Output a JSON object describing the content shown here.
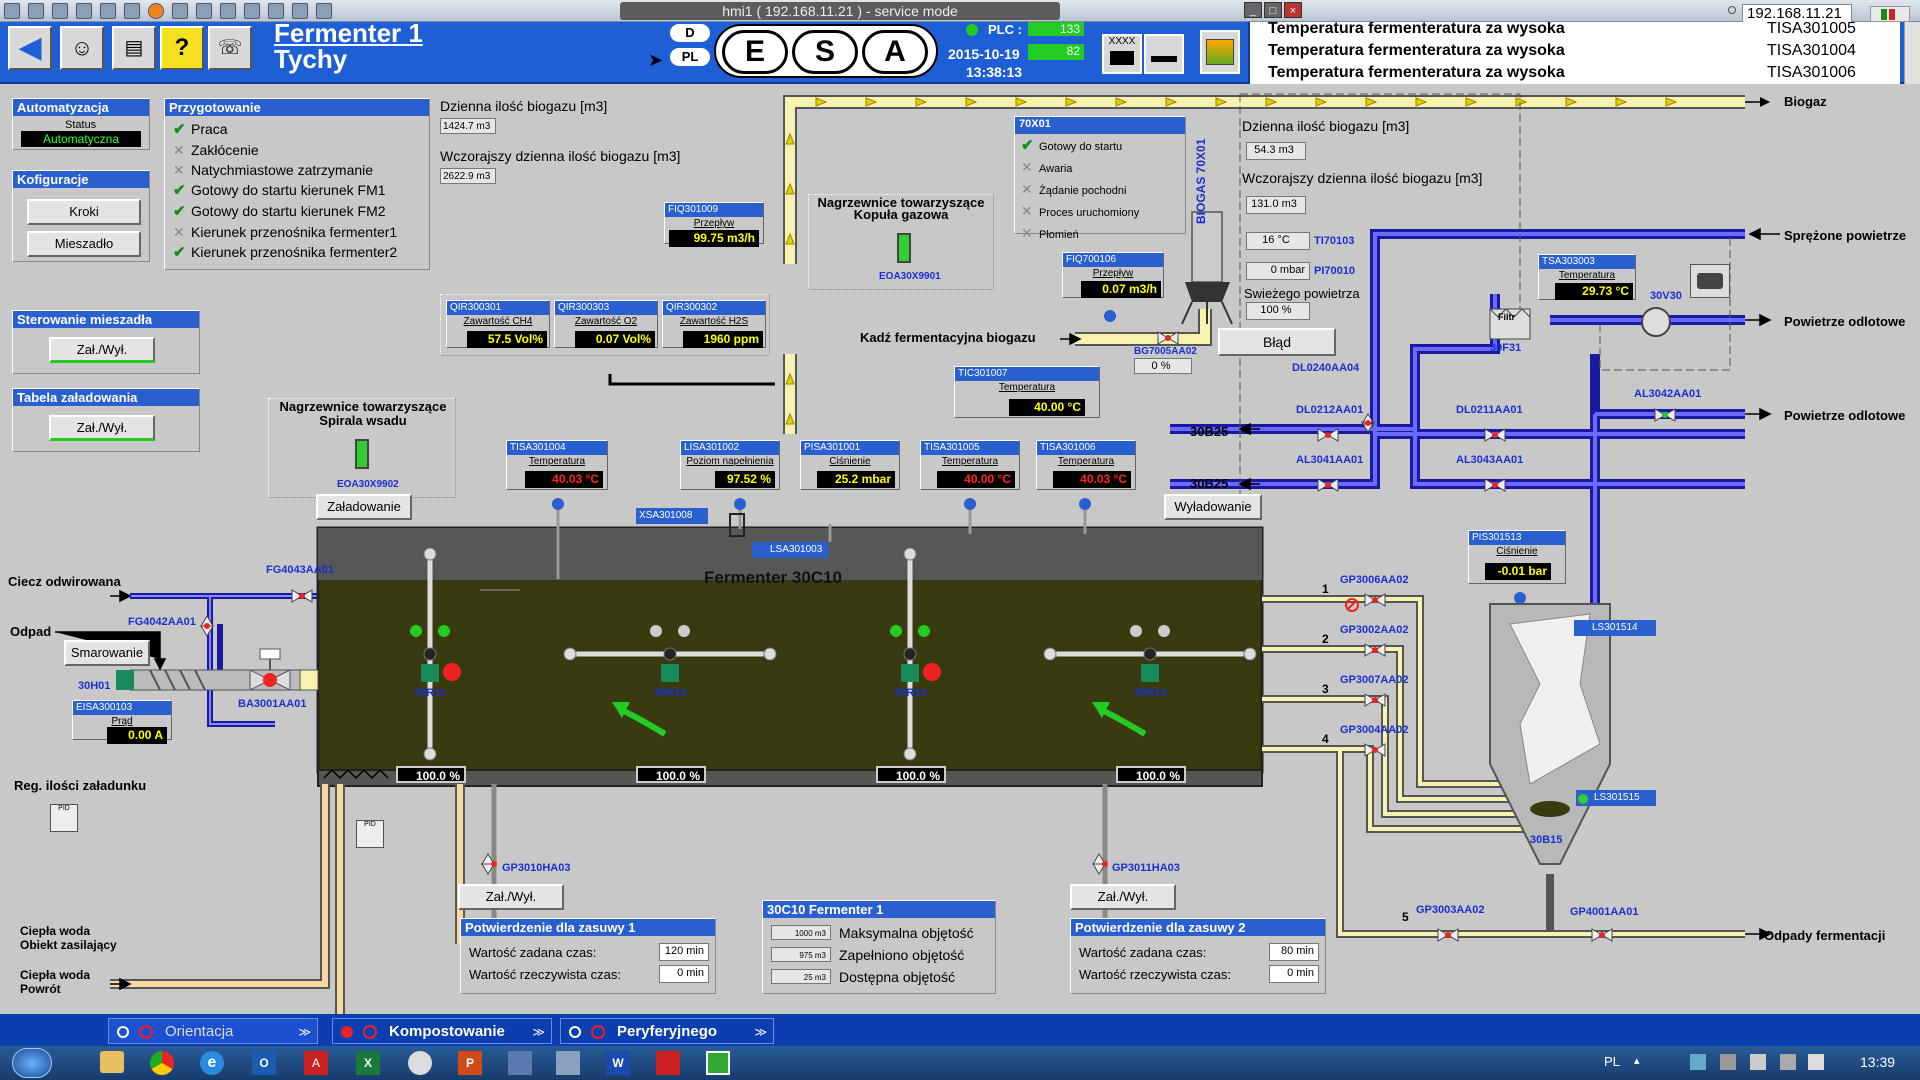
{
  "window": {
    "title": "hmi1 ( 192.168.11.21 ) - service mode",
    "ip": "192.168.11.21"
  },
  "header": {
    "title": "Fermenter 1",
    "subtitle": "Tychy",
    "d_label": "D",
    "pl_label": "PL",
    "logo_letters": [
      "E",
      "S",
      "A"
    ],
    "plc_label": "PLC :",
    "plc_val1": "133",
    "plc_val2": "82",
    "date": "2015-10-19",
    "time": "13:38:13",
    "xxxx": "XXXX"
  },
  "alarms": [
    {
      "text": "Temperatura fermenteratura za wysoka",
      "tag": "TISA301005"
    },
    {
      "text": "Temperatura fermenteratura za wysoka",
      "tag": "TISA301004"
    },
    {
      "text": "Temperatura fermenteratura za wysoka",
      "tag": "TISA301006"
    }
  ],
  "automation": {
    "title": "Automatyzacja",
    "status_label": "Status",
    "status_value": "Automatyczna"
  },
  "config": {
    "title": "Kofiguracje",
    "btn1": "Kroki",
    "btn2": "Mieszadło"
  },
  "prep": {
    "title": "Przygotowanie",
    "items": [
      {
        "label": "Praca",
        "state": "check"
      },
      {
        "label": "Zakłócenie",
        "state": "x"
      },
      {
        "label": "Natychmiastowe zatrzymanie",
        "state": "x"
      },
      {
        "label": "Gotowy do startu kierunek FM1",
        "state": "check"
      },
      {
        "label": "Gotowy do startu kierunek FM2",
        "state": "check"
      },
      {
        "label": "Kierunek  przenośnika fermenter1",
        "state": "x"
      },
      {
        "label": "Kierunek  przenośnika fermenter2",
        "state": "check"
      }
    ]
  },
  "mixer_ctrl": {
    "title": "Sterowanie mieszadła",
    "btn": "Zał./Wył."
  },
  "load_table": {
    "title": "Tabela załadowania",
    "btn": "Zał./Wył."
  },
  "biogas_daily": {
    "label": "Dzienna ilość biogazu [m3]",
    "value": "1424.7 m3",
    "label2": "Wczorajszy dzienna ilość biogazu [m3]",
    "value2": "2622.9 m3"
  },
  "biogas_daily2": {
    "label": "Dzienna ilość biogazu [m3]",
    "value": "54.3 m3",
    "label2": "Wczorajszy dzienna ilość biogazu [m3]",
    "value2": "131.0 m3",
    "temp": "16 °C",
    "temp_tag": "TI70103",
    "pres": "0 mbar",
    "pres_tag": "PI70010",
    "fresh_label": "Swieżego powietrza",
    "fresh": "100 %",
    "error": "Błąd"
  },
  "fiq301009": {
    "tag": "FIQ301009",
    "label": "Przepływ",
    "value": "99.75 m3/h"
  },
  "heaters_top": {
    "title1": "Nagrzewnice towarzyszące",
    "title2": "Kopuła gazowa",
    "tag": "EOA30X9901"
  },
  "heaters_left": {
    "title1": "Nagrzewnice towarzyszące",
    "title2": "Spirala wsadu",
    "tag": "EOA30X9902"
  },
  "gas_analysis": [
    {
      "tag": "QIR300301",
      "label": "Zawartość CH4",
      "value": "57.5 Vol%"
    },
    {
      "tag": "QIR300303",
      "label": "Zawartość O2",
      "value": "0.07 Vol%"
    },
    {
      "tag": "QIR300302",
      "label": "Zawartość H2S",
      "value": "1960 ppm"
    }
  ],
  "s70x01": {
    "title": "70X01",
    "items": [
      {
        "label": "Gotowy do startu",
        "state": "check"
      },
      {
        "label": "Awaria",
        "state": "x"
      },
      {
        "label": "Żądanie pochodni",
        "state": "x"
      },
      {
        "label": "Proces uruchomiony",
        "state": "x"
      },
      {
        "label": "Płomień",
        "state": "x"
      }
    ]
  },
  "fiq700106": {
    "tag": "FIQ700106",
    "label": "Przepływ",
    "value": "0.07 m3/h"
  },
  "biogas_tank": {
    "label": "BIOGAS",
    "id": "70X01"
  },
  "tic301007": {
    "tag": "TIC301007",
    "label": "Temperatura",
    "value": "40.00 °C"
  },
  "tsa303003": {
    "tag": "TSA303003",
    "label": "Temperatura",
    "value": "29.73 °C"
  },
  "pis301513": {
    "tag": "PIS301513",
    "label": "Ciśnienie",
    "value": "-0.01 bar"
  },
  "eisa300103": {
    "tag": "EISA300103",
    "label": "Prąd",
    "value": "0.00 A"
  },
  "tank_tags": [
    {
      "tag": "TISA301004",
      "label": "Temperatura",
      "value": "40.03 °C",
      "red": true
    },
    {
      "tag": "LISA301002",
      "label": "Poziom napełnienia",
      "value": "97.52 %",
      "red": false
    },
    {
      "tag": "PISA301001",
      "label": "Ciśnienie",
      "value": "25.2 mbar",
      "red": false
    },
    {
      "tag": "TISA301005",
      "label": "Temperatura",
      "value": "40.00 °C",
      "red": true
    },
    {
      "tag": "TISA301006",
      "label": "Temperatura",
      "value": "40.03 °C",
      "red": true
    }
  ],
  "fermenter": {
    "name": "Fermenter 30C10",
    "mixers": [
      "30R11",
      "30R12",
      "30R13",
      "30R14"
    ],
    "pcts": [
      "100.0 %",
      "100.0 %",
      "100.0 %",
      "100.0 %"
    ],
    "lsa": "LSA301003",
    "xsa": "XSA301008"
  },
  "buttons": {
    "load": "Załadowanie",
    "unload": "Wyładowanie",
    "lubricate": "Smarowanie",
    "onoff1": "Zał./Wył.",
    "onoff2": "Zał./Wył."
  },
  "valves": {
    "fg4043": "FG4043AA01",
    "fg4042": "FG4042AA01",
    "h30h01": "30H01",
    "ba3001": "BA3001AA01",
    "bg7005": "BG7005AA02",
    "bg7005_val": "0 %",
    "dl0240": "DL0240AA04",
    "dl0212": "DL0212AA01",
    "dl0211": "DL0211AA01",
    "al3041": "AL3041AA01",
    "al3043": "AL3043AA01",
    "al3042": "AL3042AA01",
    "gp3006": "GP3006AA02",
    "gp3002": "GP3002AA02",
    "gp3007": "GP3007AA02",
    "gp3004": "GP3004AA02",
    "gp3003": "GP3003AA02",
    "gp4001": "GP4001AA01",
    "gp3010": "GP3010HA03",
    "gp3011": "GP3011HA03",
    "filter": "Filtr",
    "f30f31": "30F31",
    "v30v30": "30V30",
    "ls301514": "LS301514",
    "ls301515": "LS301515",
    "b30b15": "30B15"
  },
  "labels": {
    "biogaz": "Biogaz",
    "sprezone": "Sprężone powietrze",
    "odlotowe1": "Powietrze odlotowe",
    "odlotowe2": "Powietrze odlotowe",
    "b25a": "30B25",
    "b25b": "30B25",
    "odpady": "Odpady fermentacji",
    "kadz": "Kadź fermentacyjna biogazu",
    "ciecz": "Ciecz odwirowana",
    "odpad": "Odpad",
    "reg": "Reg. ilości załadunku",
    "cw1a": "Ciepła woda",
    "cw1b": "Obiekt zasilający",
    "cw2a": "Ciepła woda",
    "cw2b": "Powrót",
    "n1": "1",
    "n2": "2",
    "n3": "3",
    "n4": "4",
    "n5": "5",
    "pid": "PID"
  },
  "conf1": {
    "title": "Potwierdzenie dla zasuwy 1",
    "set_label": "Wartość zadana czas:",
    "set": "120 min",
    "act_label": "Wartość rzeczywista czas:",
    "act": "0 min"
  },
  "conf2": {
    "title": "Potwierdzenie dla zasuwy 2",
    "set_label": "Wartość zadana czas:",
    "set": "80 min",
    "act_label": "Wartość rzeczywista czas:",
    "act": "0 min"
  },
  "volume": {
    "title": "30C10 Fermenter 1",
    "rows": [
      {
        "val": "1000 m3",
        "label": "Maksymalna objętość"
      },
      {
        "val": "975 m3",
        "label": "Zapełniono objętość"
      },
      {
        "val": "25 m3",
        "label": "Dostępna objętość"
      }
    ]
  },
  "tabs": [
    {
      "label": "Orientacja"
    },
    {
      "label": "Kompostowanie"
    },
    {
      "label": "Peryferyjnego"
    }
  ],
  "taskbar": {
    "lang": "PL",
    "clock": "13:39"
  },
  "colors": {
    "header_blue": "#1f5fd6",
    "sludge": "#3a3a10",
    "pipe_blue": "#2a2ad8",
    "pipe_yellow": "#f5f0a0"
  }
}
